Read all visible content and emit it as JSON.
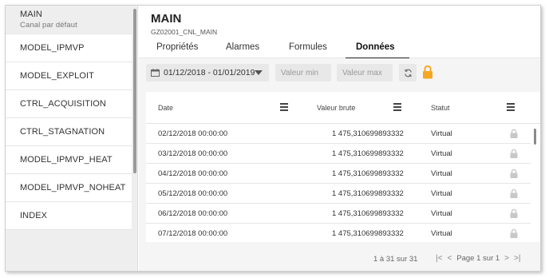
{
  "sidebar": {
    "items": [
      {
        "label": "MAIN",
        "sublabel": "Canal par défaut"
      },
      {
        "label": "MODEL_IPMVP"
      },
      {
        "label": "MODEL_EXPLOIT"
      },
      {
        "label": "CTRL_ACQUISITION"
      },
      {
        "label": "CTRL_STAGNATION"
      },
      {
        "label": "MODEL_IPMVP_HEAT"
      },
      {
        "label": "MODEL_IPMVP_NOHEAT"
      },
      {
        "label": "INDEX"
      }
    ]
  },
  "header": {
    "title": "MAIN",
    "subtitle": "GZ02001_CNL_MAIN",
    "tabs": [
      "Propriétés",
      "Alarmes",
      "Formules",
      "Données"
    ],
    "active_tab": "Données"
  },
  "toolbar": {
    "date_range": "01/12/2018 - 01/01/2019",
    "min_placeholder": "Valeur min",
    "max_placeholder": "Valeur max"
  },
  "table": {
    "columns": [
      "Date",
      "Valeur brute",
      "Statut"
    ],
    "rows": [
      {
        "date": "02/12/2018 00:00:00",
        "value": "1 475,310699893332",
        "status": "Virtual"
      },
      {
        "date": "03/12/2018 00:00:00",
        "value": "1 475,310699893332",
        "status": "Virtual"
      },
      {
        "date": "04/12/2018 00:00:00",
        "value": "1 475,310699893332",
        "status": "Virtual"
      },
      {
        "date": "05/12/2018 00:00:00",
        "value": "1 475,310699893332",
        "status": "Virtual"
      },
      {
        "date": "06/12/2018 00:00:00",
        "value": "1 475,310699893332",
        "status": "Virtual"
      },
      {
        "date": "07/12/2018 00:00:00",
        "value": "1 475,310699893332",
        "status": "Virtual"
      }
    ]
  },
  "footer": {
    "count": "1 à 31 sur 31",
    "first": "|<",
    "prev": "<",
    "page": "Page 1 sur 1",
    "next": ">",
    "last": ">|"
  },
  "colors": {
    "lock_accent": "#f5a623",
    "lock_muted": "#c8c8c8"
  }
}
